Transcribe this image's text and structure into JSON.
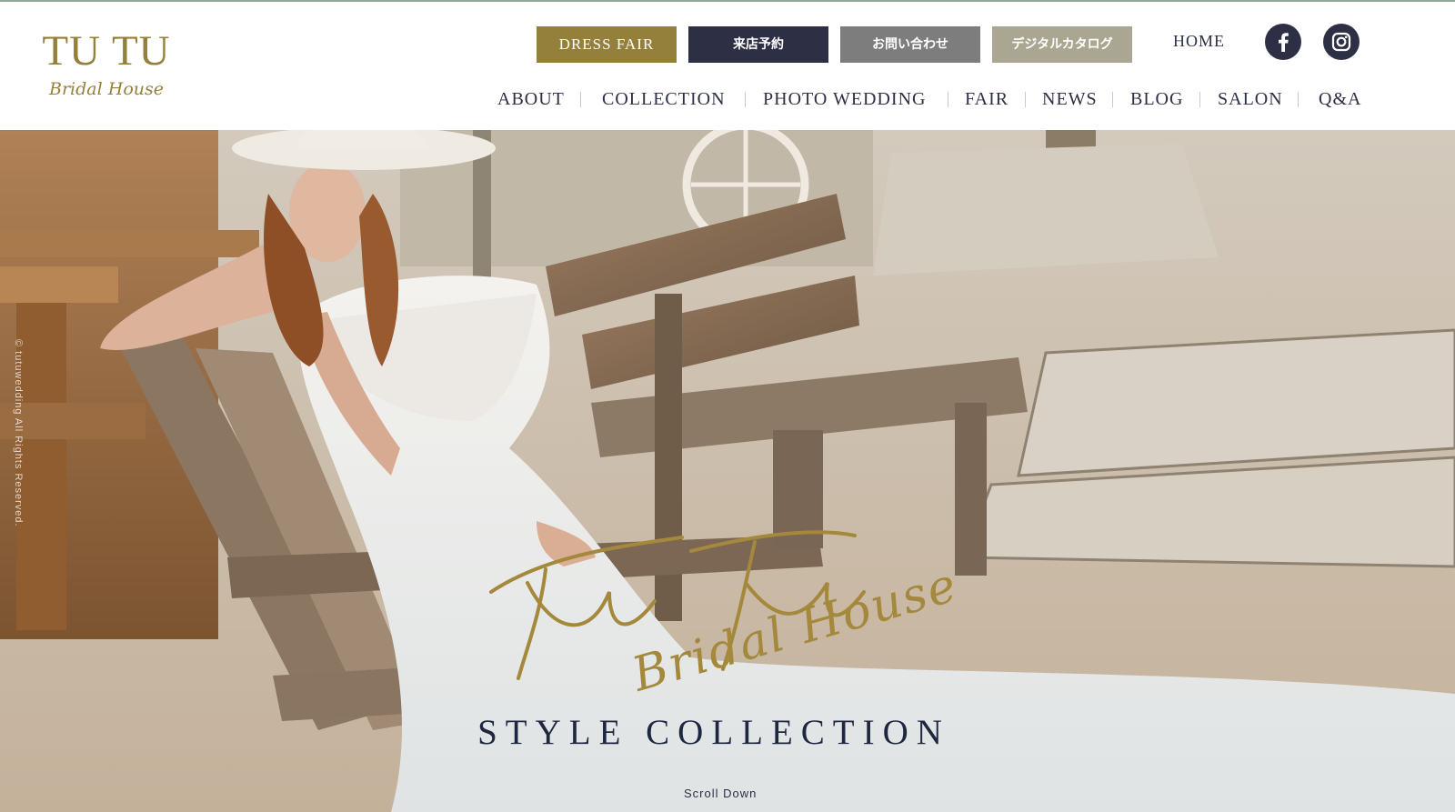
{
  "brand": {
    "logo_text": "TU TU",
    "logo_sub": "Bridal House",
    "gold": "#94803a",
    "navy": "#2d3045"
  },
  "top_buttons": {
    "dress_fair": "DRESS FAIR",
    "reserve": "来店予約",
    "contact": "お問い合わせ",
    "catalog": "デジタルカタログ"
  },
  "home": "HOME",
  "social": {
    "facebook_icon": "facebook-icon",
    "instagram_icon": "instagram-icon"
  },
  "nav": {
    "items": [
      {
        "label": "ABOUT"
      },
      {
        "label": "COLLECTION"
      },
      {
        "label": "PHOTO WEDDING"
      },
      {
        "label": "FAIR"
      },
      {
        "label": "NEWS"
      },
      {
        "label": "BLOG"
      },
      {
        "label": "SALON"
      },
      {
        "label": "Q&A"
      }
    ]
  },
  "hero": {
    "copyright": "© tutuwedding All Rights Reserved.",
    "script_main": "TuTu",
    "script_sub": "Bridal House",
    "title": "STYLE COLLECTION",
    "scroll": "Scroll Down"
  }
}
